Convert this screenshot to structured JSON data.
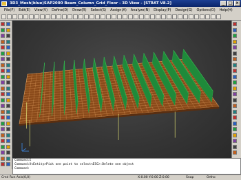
{
  "window": {
    "title": "3D3_Mesh(blue)SAP2000 Beam_Column_Grid_Floor  - 3D View - [STRAT V8.2]"
  },
  "menu": [
    "File(F)",
    "Edit(E)",
    "View(V)",
    "Define(D)",
    "Draw(R)",
    "Select(S)",
    "Assign(A)",
    "Analyze(N)",
    "Display(P)",
    "Design(G)",
    "Options(O)",
    "Help(H)"
  ],
  "command": {
    "lines": [
      "Command:E",
      "Command:X<Entity>Pick one point to select<ESC>:Delete one object",
      "Command:"
    ]
  },
  "status": {
    "left": "Cmd Run  Axis(0,0)",
    "items": [
      "X:0.00 Y:0.00 Z:0.00",
      "Snap",
      "Ortho"
    ]
  },
  "colors": {
    "deck": "#8a4a1a",
    "deck_line": "#e0a060",
    "fin": "#1f8a3a",
    "fin_light": "#34b04e",
    "column": "#d8d870"
  }
}
